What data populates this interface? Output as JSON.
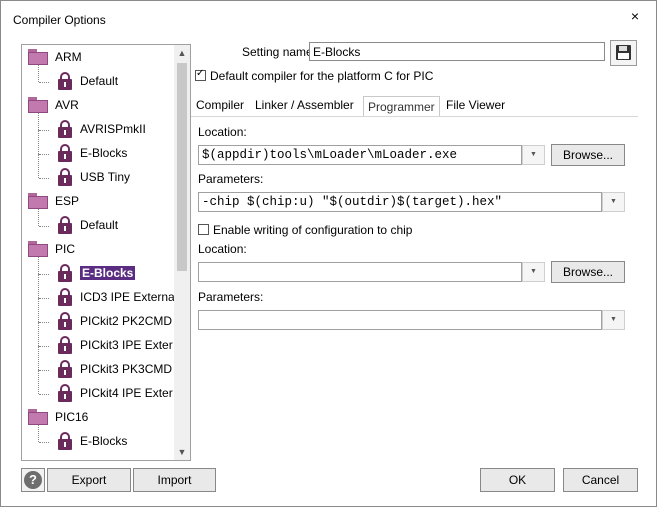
{
  "window": {
    "title": "Compiler Options",
    "close_symbol": "×"
  },
  "tree": {
    "items": [
      {
        "label": "ARM",
        "kind": "folder"
      },
      {
        "label": "Default",
        "kind": "target"
      },
      {
        "label": "AVR",
        "kind": "folder"
      },
      {
        "label": "AVRISPmkII",
        "kind": "target"
      },
      {
        "label": "E-Blocks",
        "kind": "target"
      },
      {
        "label": "USB Tiny",
        "kind": "target"
      },
      {
        "label": "ESP",
        "kind": "folder"
      },
      {
        "label": "Default",
        "kind": "target"
      },
      {
        "label": "PIC",
        "kind": "folder"
      },
      {
        "label": "E-Blocks",
        "kind": "target",
        "selected": true
      },
      {
        "label": "ICD3 IPE Externa",
        "kind": "target"
      },
      {
        "label": "PICkit2 PK2CMD",
        "kind": "target"
      },
      {
        "label": "PICkit3 IPE Exter",
        "kind": "target"
      },
      {
        "label": "PICkit3 PK3CMD",
        "kind": "target"
      },
      {
        "label": "PICkit4 IPE Exter",
        "kind": "target"
      },
      {
        "label": "PIC16",
        "kind": "folder"
      },
      {
        "label": "E-Blocks",
        "kind": "target"
      }
    ],
    "scroll_up_symbol": "▲",
    "scroll_down_symbol": "▼"
  },
  "setting": {
    "label": "Setting name:",
    "value": "E-Blocks"
  },
  "default_compiler": {
    "label": "Default compiler for the platform C for PIC",
    "checked": true
  },
  "tabs": [
    "Compiler",
    "Linker / Assembler",
    "Programmer",
    "File Viewer"
  ],
  "active_tab": "Programmer",
  "programmer": {
    "location1_label": "Location:",
    "location1_value": "$(appdir)tools\\mLoader\\mLoader.exe",
    "browse1": "Browse...",
    "params1_label": "Parameters:",
    "params1_value": "-chip $(chip:u) \"$(outdir)$(target).hex\"",
    "enable_config": {
      "label": "Enable writing of configuration to chip",
      "checked": false
    },
    "location2_label": "Location:",
    "location2_value": "",
    "browse2": "Browse...",
    "params2_label": "Parameters:",
    "params2_value": ""
  },
  "dropdown_symbol": "▼",
  "footer": {
    "help_symbol": "?",
    "export": "Export",
    "import": "Import",
    "ok": "OK",
    "cancel": "Cancel"
  },
  "colors": {
    "accent": "#5a2d82",
    "folder": "#c27aae",
    "lock": "#6a2a5c"
  }
}
